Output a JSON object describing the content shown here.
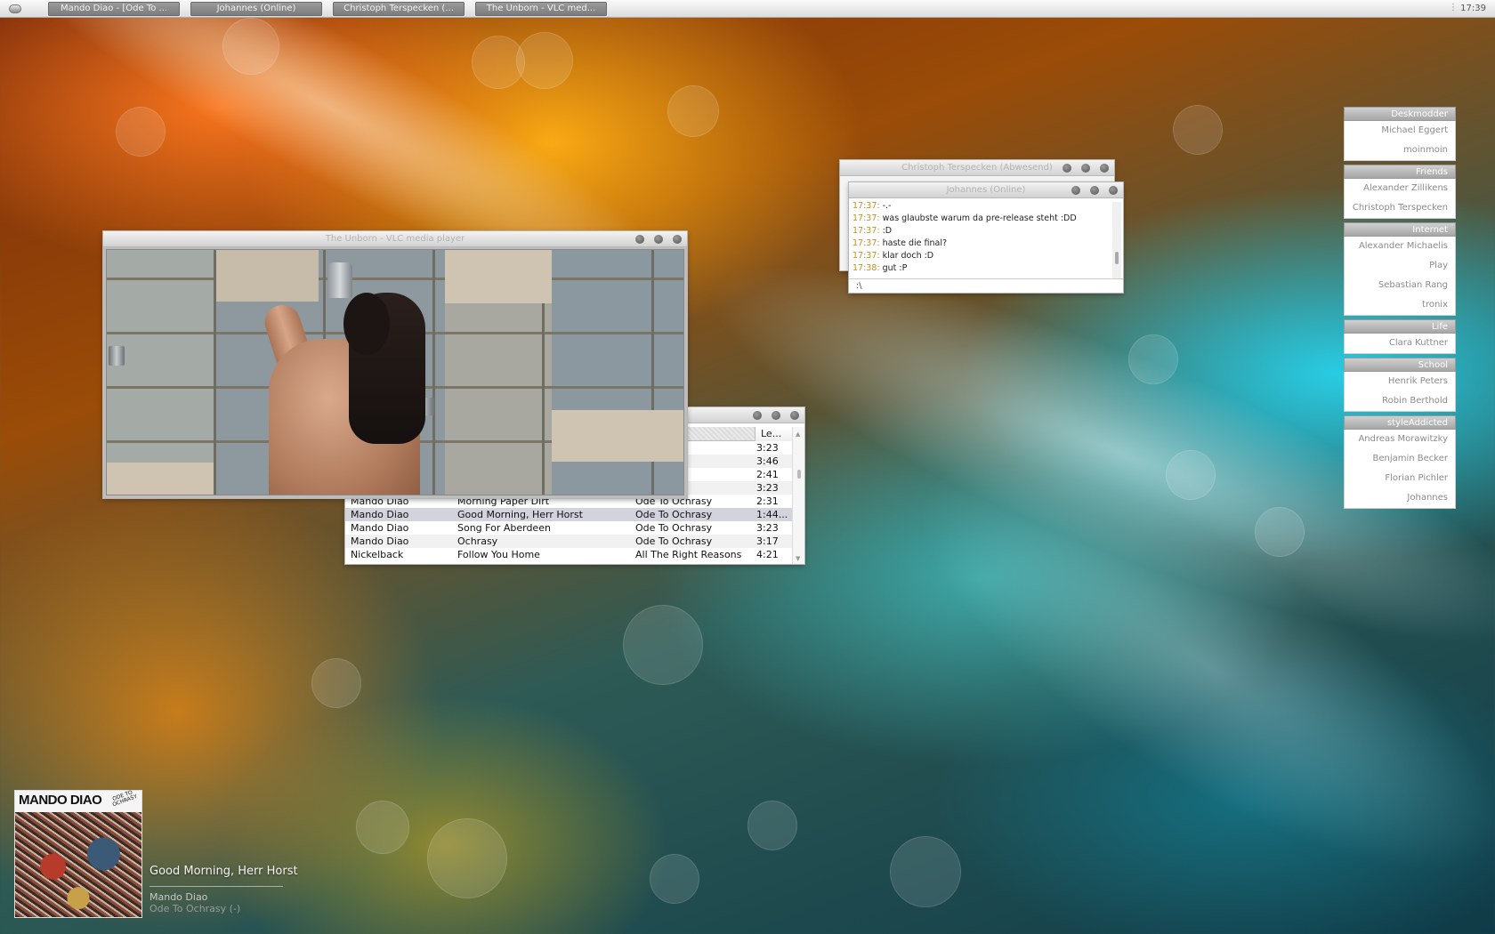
{
  "taskbar": {
    "tasks": [
      "Mando Diao - [Ode To ...",
      "Johannes (Online)",
      "Christoph Terspecken (...",
      "The Unborn - VLC med..."
    ],
    "tray_separator": "⋮",
    "clock": "17:39"
  },
  "vlc": {
    "title": "The Unborn - VLC media player"
  },
  "playlist": {
    "length_header": "Le...",
    "rows": [
      {
        "artist": "",
        "title": "",
        "album": "crasy",
        "length": "3:23"
      },
      {
        "artist": "",
        "title": "",
        "album": "crasy",
        "length": "3:46"
      },
      {
        "artist": "",
        "title": "",
        "album": "crasy",
        "length": "2:41"
      },
      {
        "artist": "",
        "title": "",
        "album": "crasy",
        "length": "3:23"
      },
      {
        "artist": "Mando Diao",
        "title": "Morning Paper Dirt",
        "album": "Ode To Ochrasy",
        "length": "2:31"
      },
      {
        "artist": "Mando Diao",
        "title": "Good Morning, Herr Horst",
        "album": "Ode To Ochrasy",
        "length": "1:44..."
      },
      {
        "artist": "Mando Diao",
        "title": "Song For Aberdeen",
        "album": "Ode To Ochrasy",
        "length": "3:23"
      },
      {
        "artist": "Mando Diao",
        "title": "Ochrasy",
        "album": "Ode To Ochrasy",
        "length": "3:17"
      },
      {
        "artist": "Nickelback",
        "title": "Follow You Home",
        "album": "All The Right Reasons",
        "length": "4:21"
      }
    ],
    "selected_index": 5
  },
  "chat_back": {
    "title": "Christoph Terspecken (Abwesend)"
  },
  "chat": {
    "title": "Johannes (Online)",
    "messages": [
      {
        "time": "17:37:",
        "text": "-.-"
      },
      {
        "time": "17:37:",
        "text": "was glaubste warum da pre-release steht :DD"
      },
      {
        "time": "17:37:",
        "text": ":D"
      },
      {
        "time": "17:37:",
        "text": "haste die final?"
      },
      {
        "time": "17:37:",
        "text": "klar doch :D"
      },
      {
        "time": "17:38:",
        "text": "gut :P"
      }
    ],
    "input_value": ":\\"
  },
  "buddy_list": {
    "groups": [
      {
        "name": "Deskmodder",
        "members": [
          "Michael Eggert",
          "moinmoin"
        ]
      },
      {
        "name": "Friends",
        "members": [
          "Alexander Zillikens",
          "Christoph Terspecken"
        ]
      },
      {
        "name": "Internet",
        "members": [
          "Alexander Michaelis",
          "Play",
          "Sebastian Rang",
          "tronix"
        ]
      },
      {
        "name": "Life",
        "members": [
          "Clara Kuttner"
        ]
      },
      {
        "name": "School",
        "members": [
          "Henrik Peters",
          "Robin Berthold"
        ]
      },
      {
        "name": "styleAddicted",
        "members": [
          "Andreas Morawitzky",
          "Benjamin Becker",
          "Florian Pichler",
          "Johannes"
        ]
      }
    ]
  },
  "now_playing": {
    "cover_band": "MANDO DIAO",
    "cover_album": "ODE TO OCHRASY",
    "title": "Good Morning, Herr Horst",
    "artist": "Mando Diao",
    "album": "Ode To Ochrasy (-)"
  },
  "colors": {
    "timestamp": "#c48e1f",
    "group_header": "#a5a5a5",
    "selected_row": "#d3d3dd"
  }
}
